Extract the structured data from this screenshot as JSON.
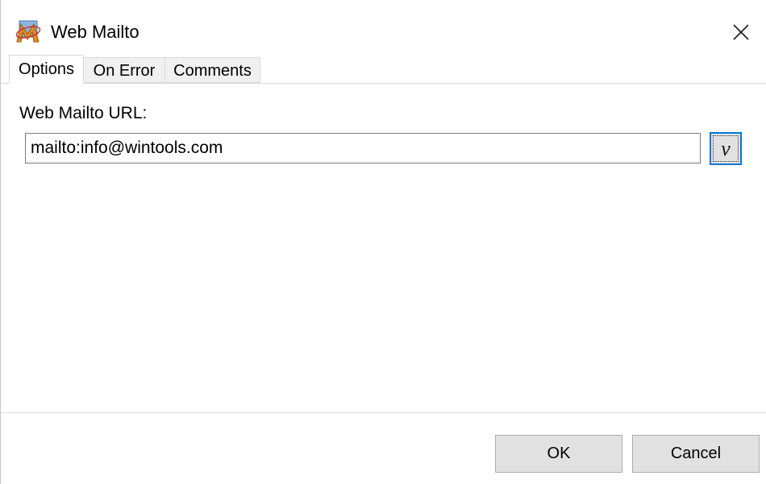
{
  "window": {
    "title": "Web Mailto",
    "app_icon": "app-logo-icon",
    "close_icon": "close-icon"
  },
  "tabs": [
    {
      "label": "Options",
      "active": true
    },
    {
      "label": "On Error",
      "active": false
    },
    {
      "label": "Comments",
      "active": false
    }
  ],
  "options": {
    "url_label": "Web Mailto URL:",
    "url_value": "mailto:info@wintools.com",
    "variable_button_label": "v"
  },
  "footer": {
    "ok_label": "OK",
    "cancel_label": "Cancel"
  },
  "colors": {
    "focus_border": "#0078d7",
    "button_bg": "#e1e1e1",
    "tab_inactive_bg": "#f0f0f0"
  }
}
